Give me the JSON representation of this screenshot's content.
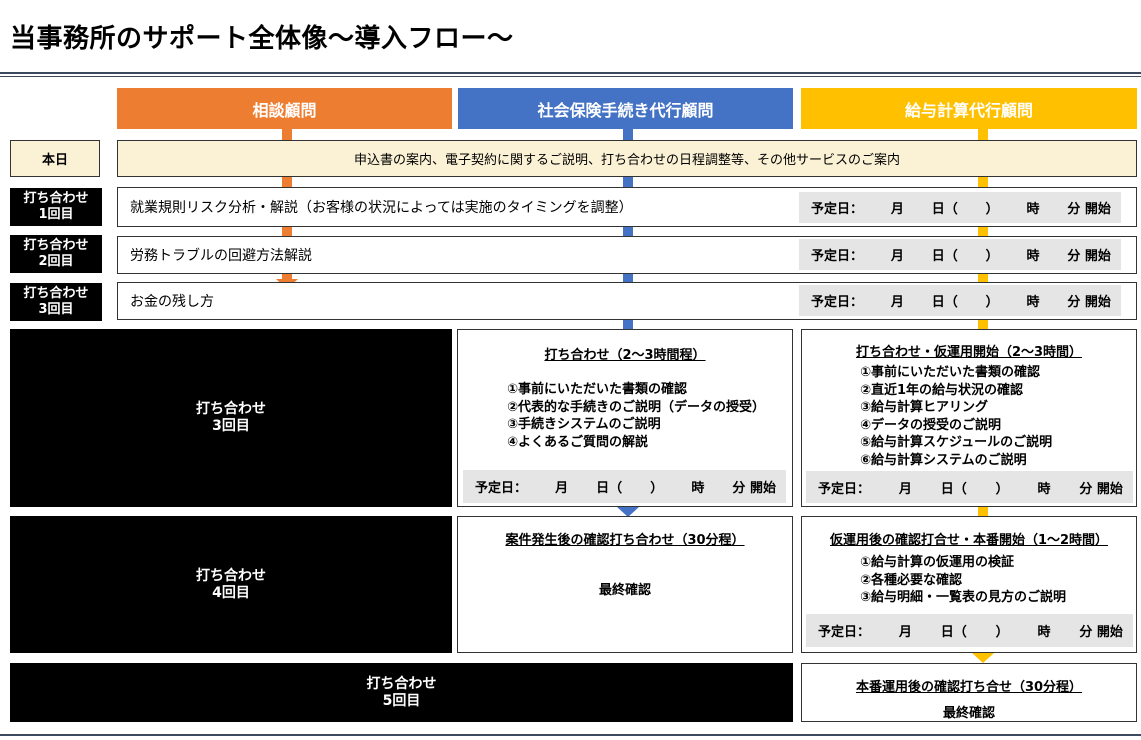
{
  "page_title": "当事務所のサポート全体像～導入フロー～",
  "columns": [
    {
      "label": "相談顧問",
      "color": "#ed7d31"
    },
    {
      "label": "社会保険手続き代行顧問",
      "color": "#4472c4"
    },
    {
      "label": "給与計算代行顧問",
      "color": "#ffc000"
    }
  ],
  "schedule_labels": [
    "予定日：",
    "月",
    "日（",
    "）",
    "時",
    "分",
    "開始"
  ],
  "today": {
    "label": "本日",
    "text": "申込書の案内、電子契約に関するご説明、打ち合わせの日程調整等、その他サービスのご案内"
  },
  "meetings": [
    {
      "line1": "打ち合わせ",
      "line2": "1回目",
      "text": "就業規則リスク分析・解説（お客様の状況によっては実施のタイミングを調整）"
    },
    {
      "line1": "打ち合わせ",
      "line2": "2回目",
      "text": "労務トラブルの回避方法解説"
    },
    {
      "line1": "打ち合わせ",
      "line2": "3回目",
      "text": "お金の残し方"
    }
  ],
  "big_meetings": [
    {
      "line1": "打ち合わせ",
      "line2": "3回目"
    },
    {
      "line1": "打ち合わせ",
      "line2": "4回目"
    },
    {
      "line1": "打ち合わせ",
      "line2": "5回目"
    }
  ],
  "shaho_m3": {
    "title": "打ち合わせ（2～3時間程）",
    "items": [
      "①事前にいただいた書類の確認",
      "②代表的な手続きのご説明（データの授受）",
      "③手続きシステムのご説明",
      "④よくあるご質問の解説"
    ]
  },
  "kyuyo_m3": {
    "title": "打ち合わせ・仮運用開始（2～3時間）",
    "items": [
      "①事前にいただいた書類の確認",
      "②直近1年の給与状況の確認",
      "③給与計算ヒアリング",
      "④データの授受のご説明",
      "⑤給与計算スケジュールのご説明",
      "⑥給与計算システムのご説明"
    ]
  },
  "shaho_m4": {
    "title": "案件発生後の確認打ち合わせ（30分程）",
    "note": "最終確認"
  },
  "kyuyo_m4": {
    "title": "仮運用後の確認打合せ・本番開始（1～2時間）",
    "items": [
      "①給与計算の仮運用の検証",
      "②各種必要な確認",
      "③給与明細・一覧表の見方のご説明"
    ]
  },
  "kyuyo_m5": {
    "title": "本番運用後の確認打ち合せ（30分程）",
    "note": "最終確認"
  }
}
